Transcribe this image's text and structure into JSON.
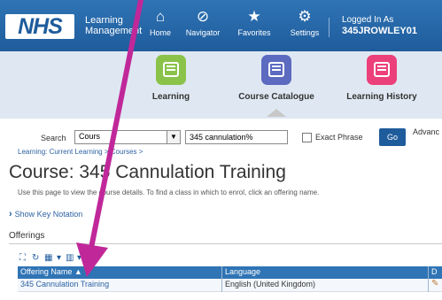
{
  "header": {
    "logo_text": "NHS",
    "app_name_line1": "Learning",
    "app_name_line2": "Management",
    "nav": [
      {
        "label": "Home",
        "icon": "home-icon",
        "glyph": "⌂"
      },
      {
        "label": "Navigator",
        "icon": "navigator-icon",
        "glyph": "⊘"
      },
      {
        "label": "Favorites",
        "icon": "star-icon",
        "glyph": "★"
      },
      {
        "label": "Settings",
        "icon": "gear-icon",
        "glyph": "⚙"
      }
    ],
    "logged_in_label": "Logged In As",
    "user": "345JROWLEY01"
  },
  "categories": [
    {
      "label": "Learning",
      "color": "#8bc34a"
    },
    {
      "label": "Course Catalogue",
      "color": "#5c6bc0"
    },
    {
      "label": "Learning History",
      "color": "#ec407a"
    }
  ],
  "search": {
    "label": "Search",
    "scope_value": "Cours",
    "query": "345 cannulation%",
    "exact_phrase_label": "Exact Phrase",
    "go_label": "Go",
    "advanced_label": "Advanc"
  },
  "page": {
    "breadcrumb": "Learning: Current Learning > Courses >",
    "title": "Course: 345 Cannulation Training",
    "instruction": "Use this page to view the course details. To find a class in which to enrol, click an offering name.",
    "show_key_label": "Show Key Notation",
    "offerings_heading": "Offerings"
  },
  "table": {
    "columns": [
      "Offering Name ▲",
      "Language",
      "D"
    ],
    "rows": [
      {
        "offering": "345 Cannulation Training",
        "language": "English (United Kingdom)",
        "icon": "details-icon"
      }
    ]
  },
  "colors": {
    "header_bg": "#1f5c9c",
    "strip_bg": "#dfe8f2",
    "link": "#2d62a3",
    "annotation_arrow": "#c0289a"
  }
}
